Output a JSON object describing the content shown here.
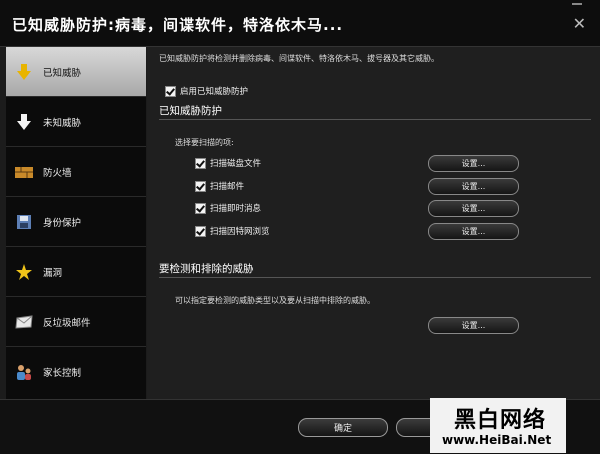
{
  "window": {
    "title": "已知威胁防护:病毒，间谍软件，特洛依木马...",
    "close_glyph": "✕"
  },
  "sidebar": {
    "items": [
      {
        "label": "已知威胁",
        "icon": "arrow-down-icon",
        "active": true
      },
      {
        "label": "未知威胁",
        "icon": "arrow-down-white-icon",
        "active": false
      },
      {
        "label": "防火墙",
        "icon": "firewall-icon",
        "active": false
      },
      {
        "label": "身份保护",
        "icon": "identity-icon",
        "active": false
      },
      {
        "label": "漏洞",
        "icon": "star-icon",
        "active": false
      },
      {
        "label": "反垃圾邮件",
        "icon": "mail-icon",
        "active": false
      },
      {
        "label": "家长控制",
        "icon": "parental-icon",
        "active": false
      }
    ]
  },
  "main": {
    "description": "已知威胁防护将检测并删除病毒、间谍软件、特洛依木马、拔号器及其它威胁。",
    "enable_checkbox": {
      "label": "启用已知威胁防护",
      "checked": true
    },
    "section1": {
      "title": "已知威胁防护",
      "subtitle": "选择要扫描的项:",
      "options": [
        {
          "label": "扫描磁盘文件",
          "checked": true,
          "button": "设置..."
        },
        {
          "label": "扫描邮件",
          "checked": true,
          "button": "设置..."
        },
        {
          "label": "扫描即时消息",
          "checked": true,
          "button": "设置..."
        },
        {
          "label": "扫描因特网浏览",
          "checked": true,
          "button": "设置..."
        }
      ]
    },
    "section2": {
      "title": "要检测和排除的威胁",
      "description": "可以指定要检测的威胁类型以及要从扫描中排除的威胁。",
      "button": "设置..."
    }
  },
  "footer": {
    "ok": "确定",
    "cancel": "取消"
  },
  "watermark": {
    "text": "黑白网络",
    "url": "www.HeiBai.Net"
  },
  "colors": {
    "accent_yellow": "#e8b400",
    "background": "#1f1f1f"
  }
}
